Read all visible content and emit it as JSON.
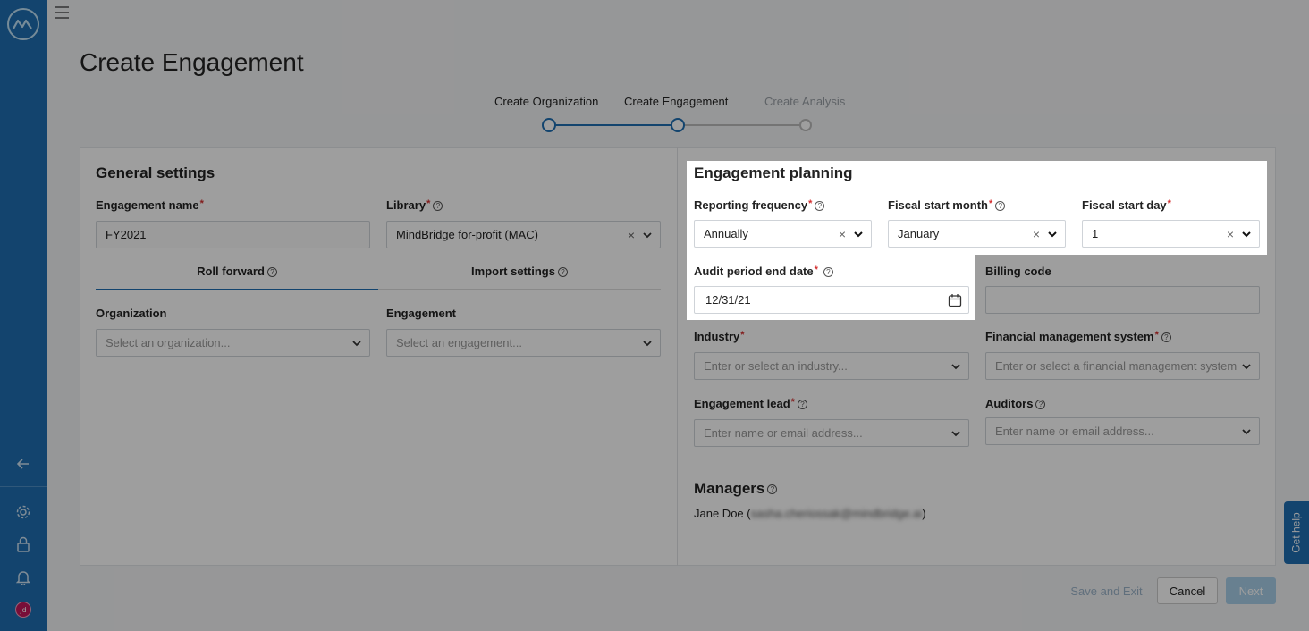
{
  "header": {
    "title": "Create Engagement"
  },
  "stepper": {
    "steps": [
      {
        "label": "Create Organization"
      },
      {
        "label": "Create Engagement"
      },
      {
        "label": "Create Analysis"
      }
    ],
    "active_color": "#1f6fb2"
  },
  "general_settings": {
    "title": "General settings",
    "engagement_name": {
      "label": "Engagement name",
      "value": "FY2021"
    },
    "library": {
      "label": "Library",
      "value": "MindBridge for-profit (MAC)"
    },
    "tabs": [
      {
        "label": "Roll forward"
      },
      {
        "label": "Import settings"
      }
    ],
    "organization": {
      "label": "Organization",
      "placeholder": "Select an organization..."
    },
    "engagement": {
      "label": "Engagement",
      "placeholder": "Select an engagement..."
    }
  },
  "engagement_planning": {
    "title": "Engagement planning",
    "reporting_frequency": {
      "label": "Reporting frequency",
      "value": "Annually"
    },
    "fiscal_start_month": {
      "label": "Fiscal start month",
      "value": "January"
    },
    "fiscal_start_day": {
      "label": "Fiscal start day",
      "value": "1"
    },
    "audit_period_end_date": {
      "label": "Audit period end date",
      "value": "12/31/21"
    },
    "billing_code": {
      "label": "Billing code",
      "value": ""
    },
    "industry": {
      "label": "Industry",
      "placeholder": "Enter or select an industry..."
    },
    "financial_management_system": {
      "label": "Financial management system",
      "placeholder": "Enter or select a financial management system"
    },
    "engagement_lead": {
      "label": "Engagement lead",
      "placeholder": "Enter name or email address..."
    },
    "auditors": {
      "label": "Auditors",
      "placeholder": "Enter name or email address..."
    }
  },
  "managers": {
    "title": "Managers",
    "items": [
      {
        "name": "Jane Doe",
        "email": "sasha.cheriossak@mindbridge.ai"
      }
    ]
  },
  "footer": {
    "save_exit_label": "Save and Exit",
    "cancel_label": "Cancel",
    "next_label": "Next"
  },
  "get_help": {
    "label": "Get help"
  },
  "user": {
    "initials": "jd"
  }
}
